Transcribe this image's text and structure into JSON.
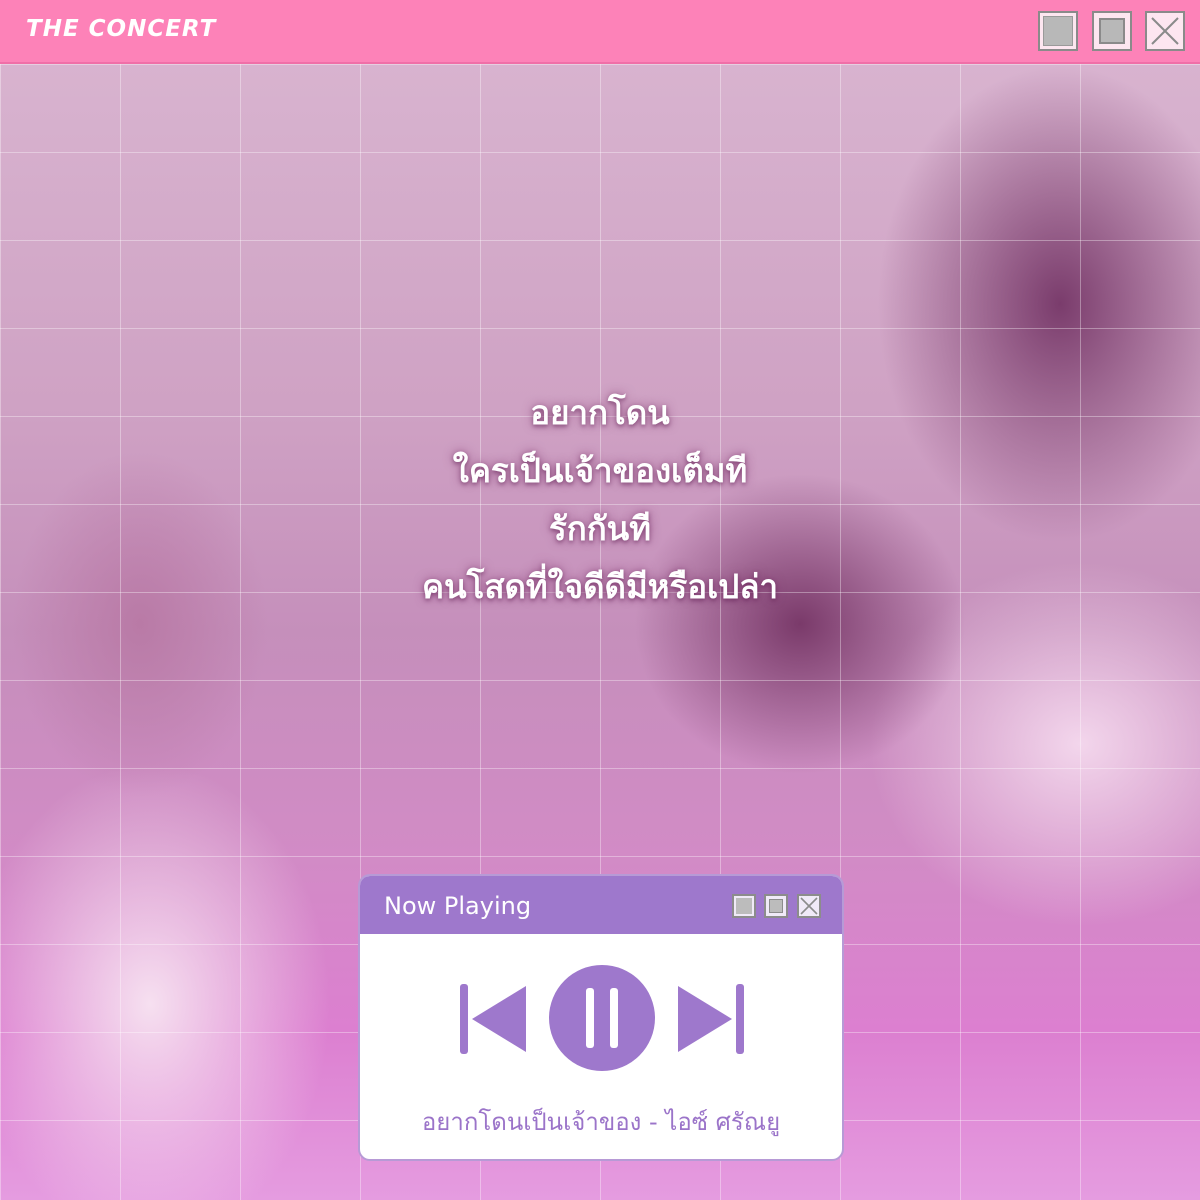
{
  "window": {
    "brand": "THE CONCERT",
    "controls": [
      "minimize",
      "maximize",
      "close"
    ]
  },
  "lyrics": [
    "อยากโดน",
    "ใครเป็นเจ้าของเต็มที",
    "รักกันที",
    "คนโสดที่ใจดีดีมีหรือเปล่า"
  ],
  "player": {
    "title": "Now Playing",
    "track": "อยากโดนเป็นเจ้าของ - ไอซ์ ศรัณยู",
    "state": "playing",
    "controls": [
      "previous",
      "pause",
      "next"
    ]
  },
  "colors": {
    "titlebar": "#fd82b8",
    "player_bar": "#9e78cc",
    "player_accent": "#9b74c9"
  },
  "icons": {
    "previous": "skip-previous-icon",
    "pause": "pause-icon",
    "next": "skip-next-icon",
    "close": "close-icon"
  }
}
